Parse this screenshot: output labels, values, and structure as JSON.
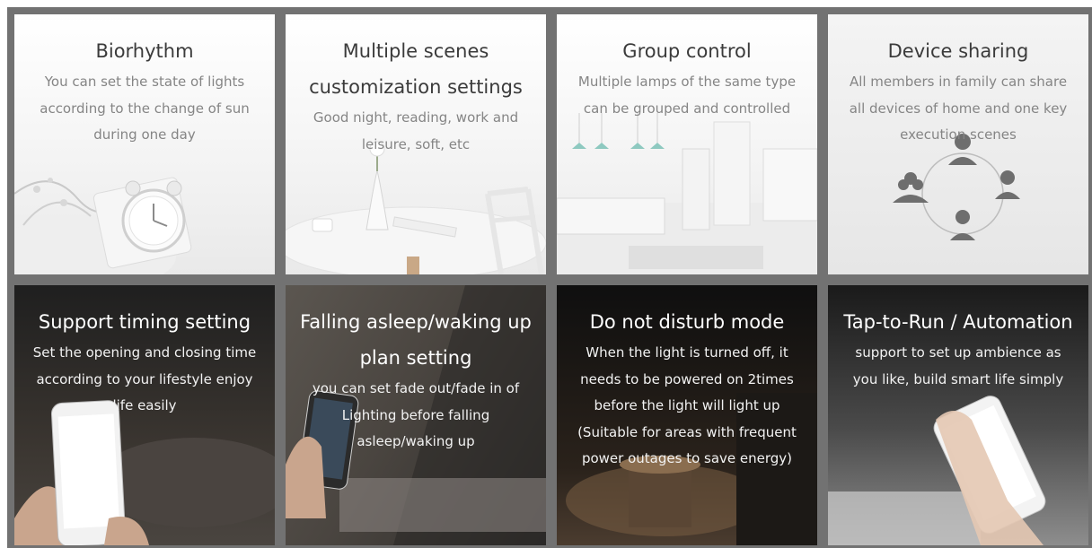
{
  "features": [
    {
      "title": "Biorhythm",
      "description": "You can set the state of lights according to the change of sun during one day",
      "icon": "alarm-clock-icon",
      "theme": "light"
    },
    {
      "title": "Multiple scenes customization settings",
      "description": "Good night, reading, work and leisure, soft, etc",
      "icon": "vase-table-icon",
      "theme": "light"
    },
    {
      "title": "Group control",
      "description": "Multiple lamps of the same type can be grouped and controlled",
      "icon": "pendant-lamps-icon",
      "theme": "light"
    },
    {
      "title": "Device sharing",
      "description": "All members in family can share all devices of home and one key execution scenes",
      "icon": "users-share-icon",
      "theme": "light"
    },
    {
      "title": "Support timing setting",
      "description": "Set the opening and closing time according to your lifestyle enjoy life easily",
      "icon": "phone-in-hand-icon",
      "theme": "dark"
    },
    {
      "title": "Falling asleep/waking up plan setting",
      "description": "you can set fade out/fade in of Lighting before falling asleep/waking up",
      "icon": "phone-in-hand-icon",
      "theme": "dark"
    },
    {
      "title": "Do not disturb mode",
      "description": "When the light is turned off, it needs to be powered on 2times before the light will light up (Suitable for areas with frequent power outages to save energy)",
      "icon": "night-lamp-icon",
      "theme": "dark"
    },
    {
      "title": "Tap-to-Run / Automation",
      "description": "support to set up ambience as you like, build smart life simply",
      "icon": "phone-in-hand-icon",
      "theme": "dark"
    }
  ],
  "colors": {
    "frame": "#727272",
    "light_title": "#3b3b3b",
    "light_text": "#858585",
    "dark_title": "#ffffff",
    "dark_text": "#f2f2f2"
  }
}
